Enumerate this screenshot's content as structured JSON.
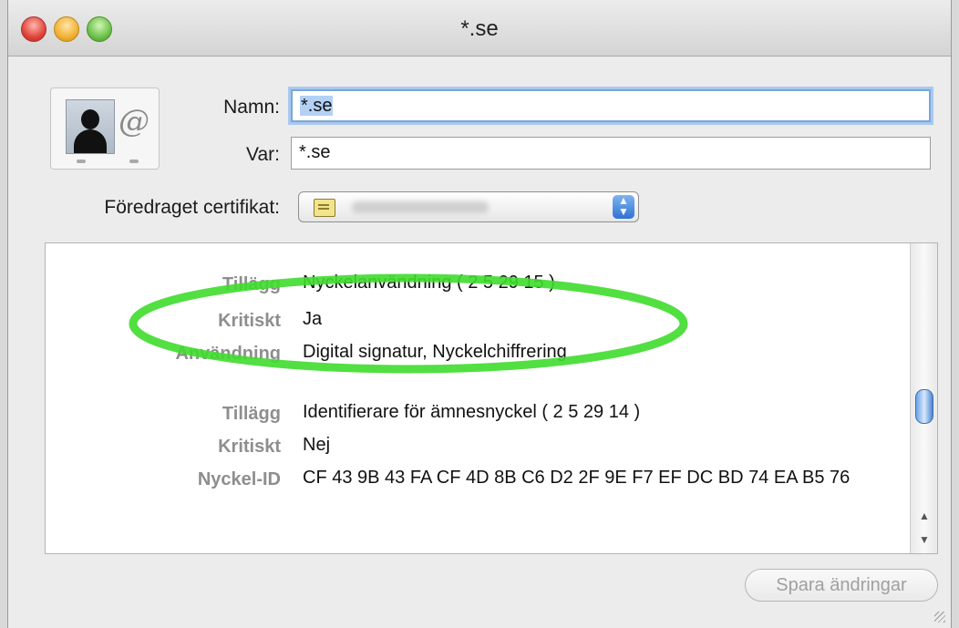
{
  "window": {
    "title": "*.se"
  },
  "form": {
    "name_label": "Namn:",
    "name_value": "*.se",
    "where_label": "Var:",
    "where_value": "*.se",
    "cert_label": "Föredraget certifikat:"
  },
  "details": [
    {
      "label": "Tillägg",
      "value": "Nyckelanvändning ( 2 5 29 15 )"
    },
    {
      "label": "Kritiskt",
      "value": "Ja"
    },
    {
      "label": "Användning",
      "value": "Digital signatur, Nyckelchiffrering"
    },
    {
      "label": "Tillägg",
      "value": "Identifierare för ämnesnyckel ( 2 5 29 14 )"
    },
    {
      "label": "Kritiskt",
      "value": "Nej"
    },
    {
      "label": "Nyckel-ID",
      "value": "CF 43 9B 43 FA CF 4D 8B C6 D2 2F 9E F7 EF DC BD 74 EA B5 76"
    }
  ],
  "buttons": {
    "save_label": "Spara ändringar"
  },
  "colors": {
    "highlight": "#3fdc2c",
    "focus_ring": "#a9c8ee"
  }
}
